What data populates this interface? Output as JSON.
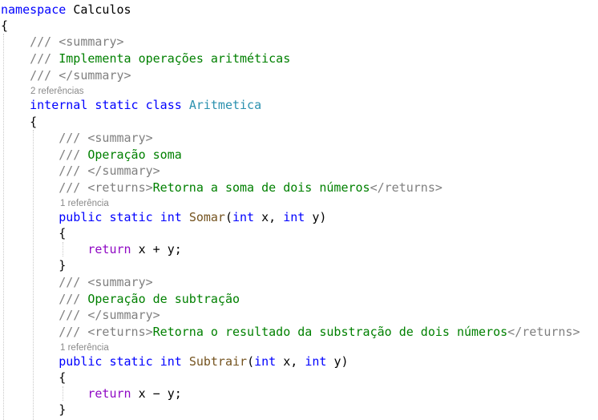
{
  "code": {
    "keywords": {
      "namespace": "namespace",
      "internal": "internal",
      "static": "static",
      "class": "class",
      "public": "public",
      "int": "int",
      "return": "return"
    },
    "namespace_name": "Calculos",
    "class_name": "Aritmetica",
    "doc_prefix": "///",
    "summary_open": "<summary>",
    "summary_close": "</summary>",
    "returns_open": "<returns>",
    "returns_close": "</returns>",
    "brace_open": "{",
    "brace_close": "}",
    "class_doc_text": "Implementa operações aritméticas",
    "class_references": "2 referências",
    "methods": [
      {
        "summary_text": "Operação soma",
        "returns_text": "Retorna a soma de dois números",
        "references": "1 referência",
        "name": "Somar",
        "params": "(int x, int y)",
        "param_x": "x",
        "param_y": "y",
        "operator": "+",
        "expr_x": "x",
        "expr_y": "y;"
      },
      {
        "summary_text": "Operação de subtração",
        "returns_text": "Retorna o resultado da substração de dois números",
        "references": "1 referência",
        "name": "Subtrair",
        "params": "(int x, int y)",
        "param_x": "x",
        "param_y": "y",
        "operator": "−",
        "expr_x": "x",
        "expr_y": "y;"
      }
    ]
  },
  "colors": {
    "keyword": "#0000ff",
    "control_keyword": "#8f08c4",
    "comment": "#008000",
    "doc_tag": "#808080",
    "type_name": "#2b91af",
    "method_name": "#74531f",
    "codelens": "#8a8a8a"
  }
}
